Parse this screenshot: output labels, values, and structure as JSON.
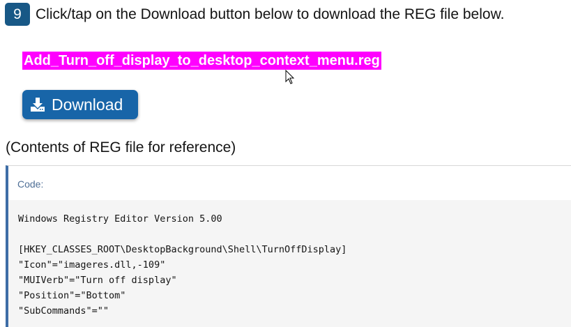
{
  "step": {
    "number": "9",
    "instruction": "Click/tap on the Download button below to download the REG file below."
  },
  "reg_file": {
    "link_text": "Add_Turn_off_display_to_desktop_context_menu.reg"
  },
  "download_button": {
    "label": "Download",
    "icon": "download-icon"
  },
  "reference_text": "(Contents of REG file for reference)",
  "code_block": {
    "header": "Code:",
    "lines": [
      "Windows Registry Editor Version 5.00",
      "",
      "[HKEY_CLASSES_ROOT\\DesktopBackground\\Shell\\TurnOffDisplay]",
      "\"Icon\"=\"imageres.dll,-109\"",
      "\"MUIVerb\"=\"Turn off display\"",
      "\"Position\"=\"Bottom\"",
      "\"SubCommands\"=\"\""
    ]
  },
  "colors": {
    "step_badge": "#185886",
    "link_highlight": "#ff00ff",
    "button": "#1865a8",
    "code_border": "#3e6da6",
    "code_background": "#f5f5f5"
  }
}
